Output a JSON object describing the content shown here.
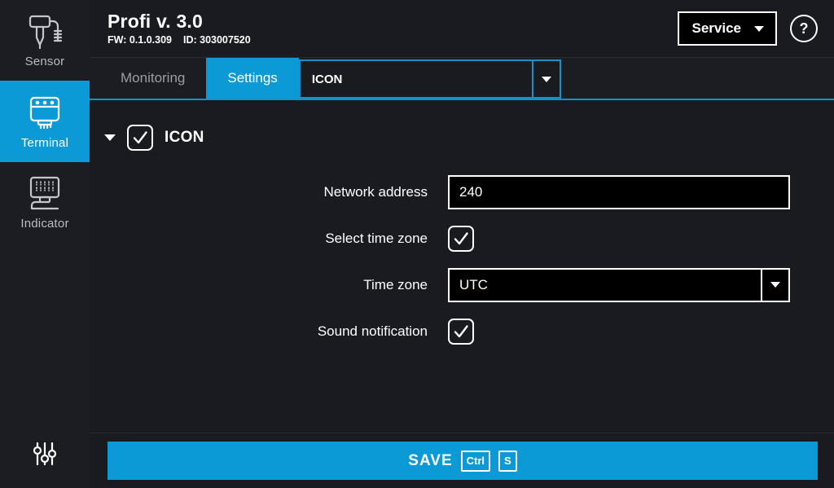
{
  "sidebar": {
    "items": [
      {
        "label": "Sensor",
        "icon": "sensor-probe-icon",
        "active": false
      },
      {
        "label": "Terminal",
        "icon": "terminal-device-icon",
        "active": true
      },
      {
        "label": "Indicator",
        "icon": "indicator-panel-icon",
        "active": false
      }
    ],
    "bottom": {
      "icon": "sliders-settings-icon",
      "label": "Settings"
    }
  },
  "header": {
    "title": "Profi v. 3.0",
    "firmware": "FW: 0.1.0.309",
    "device_id": "ID: 303007520",
    "service_button": "Service",
    "help_button": "?"
  },
  "tabs": {
    "items": [
      {
        "label": "Monitoring",
        "active": false
      },
      {
        "label": "Settings",
        "active": true
      }
    ],
    "combo": {
      "value": "ICON",
      "caret": "chevron-down-icon"
    }
  },
  "group": {
    "label": "ICON",
    "expanded": true,
    "checked": true
  },
  "form": {
    "rows": [
      {
        "label": "Network address",
        "type": "text",
        "value": "240",
        "placeholder": ""
      },
      {
        "label": "Select time zone",
        "type": "checkbox",
        "checked": true
      },
      {
        "label": "Time zone",
        "type": "select",
        "value": "UTC"
      },
      {
        "label": "Sound notification",
        "type": "checkbox",
        "checked": true
      }
    ]
  },
  "footer": {
    "save_label": "SAVE",
    "shortcut_mod": "Ctrl",
    "shortcut_key": "S"
  },
  "colors": {
    "accent": "#0c9ad6",
    "accent_line": "#1a8fc4",
    "panel_bg": "#191b21",
    "sidebar_bg": "#1b1d23",
    "text": "#ffffff",
    "muted_text": "#9a9da3"
  }
}
